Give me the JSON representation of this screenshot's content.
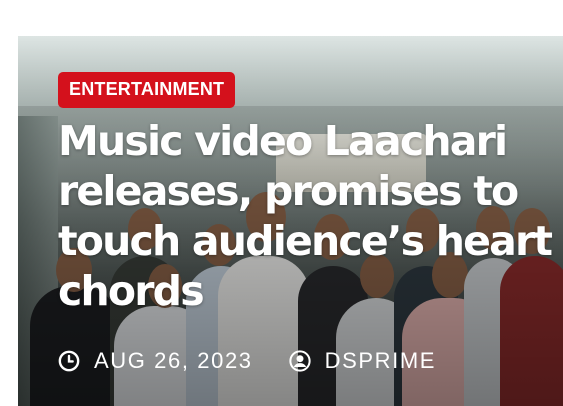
{
  "article": {
    "category": "ENTERTAINMENT",
    "headline": "Music video Laachari releases, promises to touch audience’s heart chords",
    "date": "AUG 26, 2023",
    "author": "DSPRIME"
  },
  "icons": {
    "date": "clock-icon",
    "author": "user-circle-icon"
  },
  "colors": {
    "category_badge": "#d4111c",
    "text": "#ffffff"
  }
}
